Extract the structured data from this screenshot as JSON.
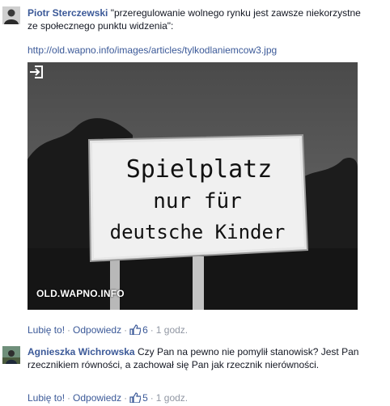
{
  "comments": [
    {
      "author": "Piotr Sterczewski",
      "text": "\"przeregulowanie wolnego rynku jest zawsze niekorzystne ze społecznego punktu widzenia\":",
      "link": "http://old.wapno.info/images/articles/tylkodlaniemcow3.jpg",
      "preview": {
        "watermark": "OLD.WAPNO.INFO",
        "sign_lines": [
          "Spielplatz",
          "nur für",
          "deutsche Kinder"
        ]
      },
      "actions": {
        "like": "Lubię to!",
        "reply": "Odpowiedz",
        "likes": "6",
        "time": "1 godz."
      }
    },
    {
      "author": "Agnieszka Wichrowska",
      "text": "Czy Pan na pewno nie pomylił stanowisk? Jest Pan rzecznikiem równości, a zachował się Pan jak rzecznik nierówności.",
      "actions": {
        "like": "Lubię to!",
        "reply": "Odpowiedz",
        "likes": "5",
        "time": "1 godz."
      }
    }
  ]
}
